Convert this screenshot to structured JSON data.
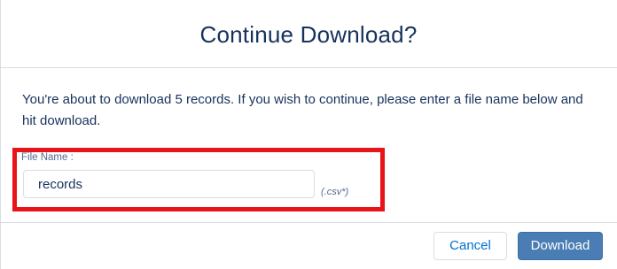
{
  "dialog": {
    "title": "Continue Download?",
    "message": "You're about to download 5 records. If you wish to continue, please enter a file name below and hit download."
  },
  "file_field": {
    "label": "File Name :",
    "value": "records",
    "suffix": "(.csv*)"
  },
  "footer": {
    "cancel_label": "Cancel",
    "download_label": "Download"
  },
  "colors": {
    "highlight": "#e8141a",
    "brand_button": "#4a7db3",
    "link": "#0070d2",
    "text": "#16325c"
  }
}
